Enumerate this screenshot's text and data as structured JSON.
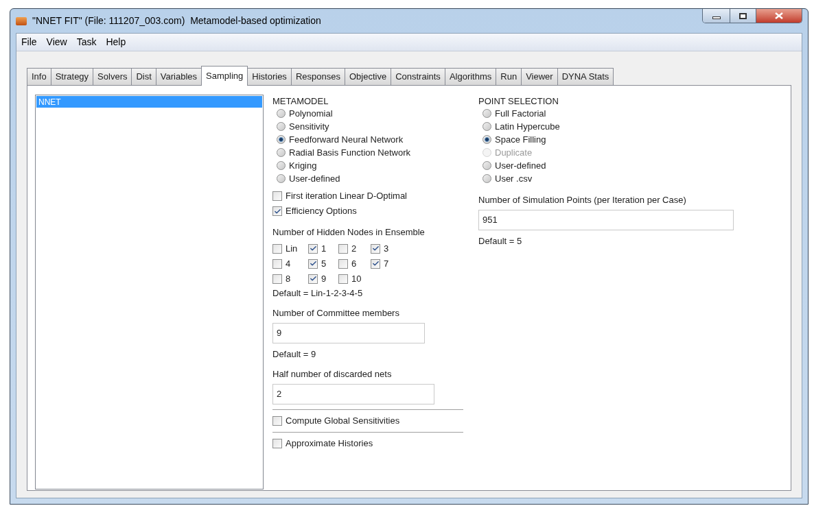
{
  "window": {
    "title": "\"NNET FIT\" (File: 111207_003.com)  Metamodel-based optimization"
  },
  "menu": [
    "File",
    "View",
    "Task",
    "Help"
  ],
  "tabs": [
    {
      "label": "Info",
      "selected": false
    },
    {
      "label": "Strategy",
      "selected": false
    },
    {
      "label": "Solvers",
      "selected": false
    },
    {
      "label": "Dist",
      "selected": false
    },
    {
      "label": "Variables",
      "selected": false
    },
    {
      "label": "Sampling",
      "selected": true
    },
    {
      "label": "Histories",
      "selected": false
    },
    {
      "label": "Responses",
      "selected": false
    },
    {
      "label": "Objective",
      "selected": false
    },
    {
      "label": "Constraints",
      "selected": false
    },
    {
      "label": "Algorithms",
      "selected": false
    },
    {
      "label": "Run",
      "selected": false
    },
    {
      "label": "Viewer",
      "selected": false
    },
    {
      "label": "DYNA Stats",
      "selected": false
    }
  ],
  "case_list": [
    {
      "label": "NNET",
      "selected": true
    }
  ],
  "metamodel": {
    "heading": "METAMODEL",
    "options": [
      {
        "label": "Polynomial",
        "selected": false,
        "disabled": false
      },
      {
        "label": "Sensitivity",
        "selected": false,
        "disabled": false
      },
      {
        "label": "Feedforward Neural Network",
        "selected": true,
        "disabled": false
      },
      {
        "label": "Radial Basis Function Network",
        "selected": false,
        "disabled": false
      },
      {
        "label": "Kriging",
        "selected": false,
        "disabled": false
      },
      {
        "label": "User-defined",
        "selected": false,
        "disabled": false
      }
    ]
  },
  "metamodel_flags": [
    {
      "label": "First iteration Linear D-Optimal",
      "checked": false
    },
    {
      "label": "Efficiency Options",
      "checked": true
    }
  ],
  "hidden_nodes": {
    "label": "Number of Hidden Nodes in Ensemble",
    "options": [
      {
        "label": "Lin",
        "checked": false
      },
      {
        "label": "1",
        "checked": true
      },
      {
        "label": "2",
        "checked": false
      },
      {
        "label": "3",
        "checked": true
      },
      {
        "label": "4",
        "checked": false
      },
      {
        "label": "5",
        "checked": true
      },
      {
        "label": "6",
        "checked": false
      },
      {
        "label": "7",
        "checked": true
      },
      {
        "label": "8",
        "checked": false
      },
      {
        "label": "9",
        "checked": true
      },
      {
        "label": "10",
        "checked": false
      }
    ],
    "default": "Default = Lin-1-2-3-4-5"
  },
  "committee": {
    "label": "Number of Committee members",
    "value": "9",
    "default": "Default = 9"
  },
  "discarded": {
    "label": "Half number of discarded nets",
    "value": "2"
  },
  "global_sensitivities": {
    "label": "Compute Global Sensitivities",
    "checked": false
  },
  "approximate_histories": {
    "label": "Approximate Histories",
    "checked": false
  },
  "point_selection": {
    "heading": "POINT SELECTION",
    "options": [
      {
        "label": "Full Factorial",
        "selected": false,
        "disabled": false
      },
      {
        "label": "Latin Hypercube",
        "selected": false,
        "disabled": false
      },
      {
        "label": "Space Filling",
        "selected": true,
        "disabled": false
      },
      {
        "label": "Duplicate",
        "selected": false,
        "disabled": true
      },
      {
        "label": "User-defined",
        "selected": false,
        "disabled": false
      },
      {
        "label": "User .csv",
        "selected": false,
        "disabled": false
      }
    ]
  },
  "simulation_points": {
    "label": "Number of Simulation Points (per Iteration per Case)",
    "value": "951",
    "default": "Default = 5"
  }
}
